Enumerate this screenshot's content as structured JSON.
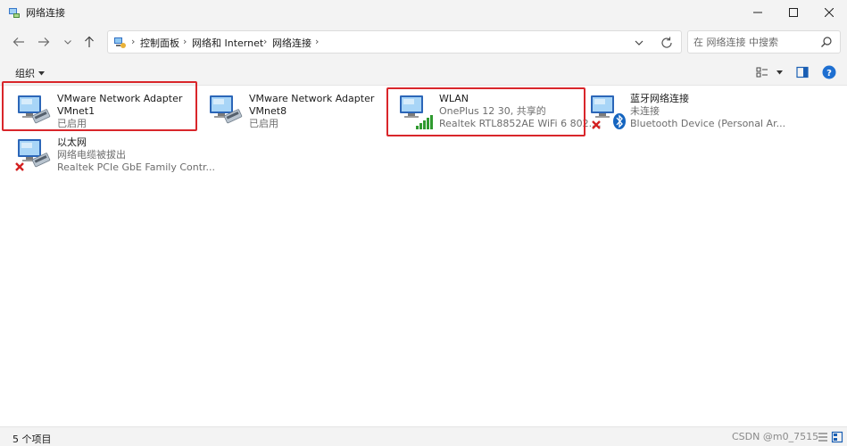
{
  "window": {
    "title": "网络连接"
  },
  "nav": {
    "breadcrumbs": [
      "控制面板",
      "网络和 Internet",
      "网络连接"
    ],
    "search_placeholder": "在 网络连接 中搜索"
  },
  "command_bar": {
    "organize_label": "组织"
  },
  "connections": [
    {
      "name": "VMware Network Adapter",
      "line2": "VMnet1",
      "line3": "已启用",
      "type": "ethernet",
      "state": "enabled",
      "highlighted": true
    },
    {
      "name": "VMware Network Adapter",
      "line2": "VMnet8",
      "line3": "已启用",
      "type": "ethernet",
      "state": "enabled",
      "highlighted": false
    },
    {
      "name": "WLAN",
      "line2": "OnePlus 12 30, 共享的",
      "line3": "Realtek RTL8852AE WiFi 6 802....",
      "type": "wifi",
      "state": "connected",
      "highlighted": true
    },
    {
      "name": "蓝牙网络连接",
      "line2": "未连接",
      "line3": "Bluetooth Device (Personal Ar...",
      "type": "bluetooth",
      "state": "disconnected",
      "highlighted": false
    },
    {
      "name": "以太网",
      "line2": "网络电缆被拔出",
      "line3": "Realtek PCIe GbE Family Contr...",
      "type": "ethernet",
      "state": "unplugged",
      "highlighted": false
    }
  ],
  "status": {
    "item_count": "5 个项目"
  },
  "watermark": "CSDN @m0_7515",
  "colors": {
    "highlight_border": "#d9262b",
    "chrome_bg": "#f3f3f3",
    "secondary_text": "#6d6d6d"
  }
}
